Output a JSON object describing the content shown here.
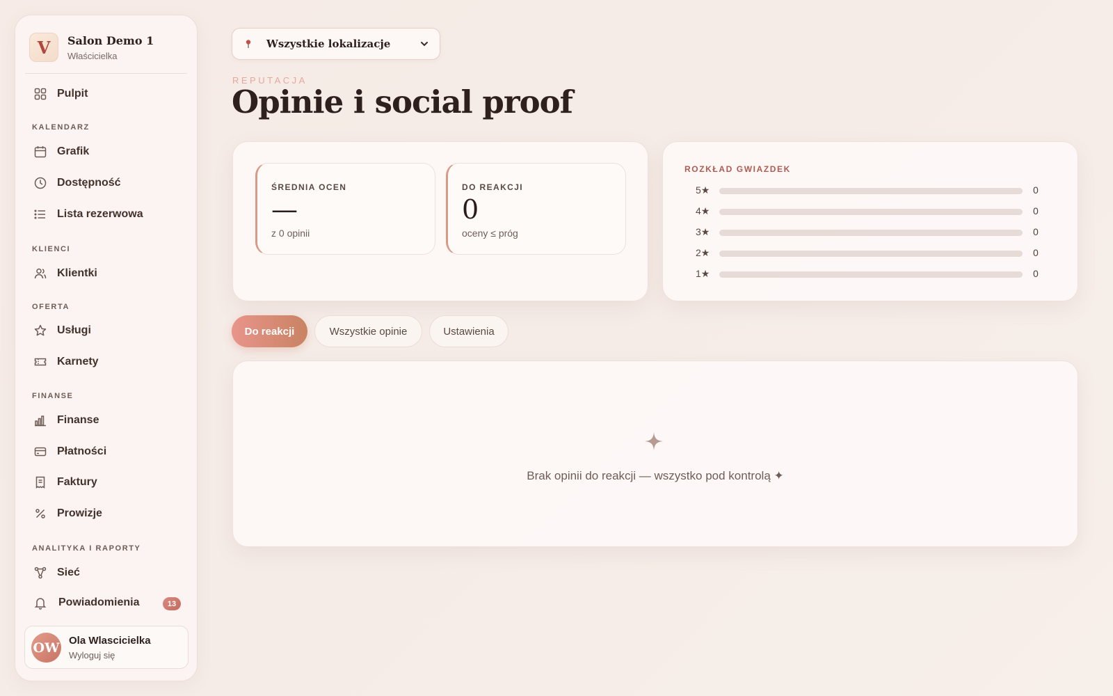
{
  "brand": {
    "logo_letter": "V",
    "name": "Salon Demo 1",
    "role": "Właścicielka"
  },
  "sidebar": {
    "items": [
      {
        "label": "Pulpit",
        "icon": "grid-icon"
      },
      {
        "section": "KALENDARZ"
      },
      {
        "label": "Grafik",
        "icon": "calendar-icon"
      },
      {
        "label": "Dostępność",
        "icon": "clock-icon"
      },
      {
        "label": "Lista rezerwowa",
        "icon": "list-icon"
      },
      {
        "section": "KLIENCI"
      },
      {
        "label": "Klientki",
        "icon": "users-icon"
      },
      {
        "section": "OFERTA"
      },
      {
        "label": "Usługi",
        "icon": "star-icon"
      },
      {
        "label": "Karnety",
        "icon": "ticket-icon"
      },
      {
        "section": "FINANSE"
      },
      {
        "label": "Finanse",
        "icon": "bar-chart-icon"
      },
      {
        "label": "Płatności",
        "icon": "credit-card-icon"
      },
      {
        "label": "Faktury",
        "icon": "receipt-icon"
      },
      {
        "label": "Prowizje",
        "icon": "percent-icon"
      },
      {
        "section": "ANALITYKA I RAPORTY"
      },
      {
        "label": "Sieć",
        "icon": "network-icon"
      },
      {
        "label": "Powiadomienia",
        "icon": "bell-icon",
        "badge": "13"
      }
    ]
  },
  "user": {
    "initials": "OW",
    "name": "Ola Wlascicielka",
    "logout": "Wyloguj się"
  },
  "location_select": {
    "value": "Wszystkie lokalizacje"
  },
  "header": {
    "eyebrow": "REPUTACJA",
    "title": "Opinie i social proof"
  },
  "stats": [
    {
      "label": "ŚREDNIA OCEN",
      "value": "—",
      "sub": "z 0 opinii"
    },
    {
      "label": "DO REAKCJI",
      "value": "0",
      "sub": "oceny ≤ próg"
    }
  ],
  "distribution": {
    "title": "ROZKŁAD GWIAZDEK",
    "rows": [
      {
        "stars": "5★",
        "count": "0",
        "fraction": 0
      },
      {
        "stars": "4★",
        "count": "0",
        "fraction": 0
      },
      {
        "stars": "3★",
        "count": "0",
        "fraction": 0
      },
      {
        "stars": "2★",
        "count": "0",
        "fraction": 0
      },
      {
        "stars": "1★",
        "count": "0",
        "fraction": 0
      }
    ]
  },
  "tabs": [
    {
      "label": "Do reakcji",
      "active": true
    },
    {
      "label": "Wszystkie opinie",
      "active": false
    },
    {
      "label": "Ustawienia",
      "active": false
    }
  ],
  "empty_state": {
    "icon": "sparkle-icon",
    "text": "Brak opinii do reakcji — wszystko pod kontrolą ✦"
  },
  "colors": {
    "accent": "#d5877b",
    "accent_dark": "#b05a52",
    "badge": "#c46a5f"
  }
}
